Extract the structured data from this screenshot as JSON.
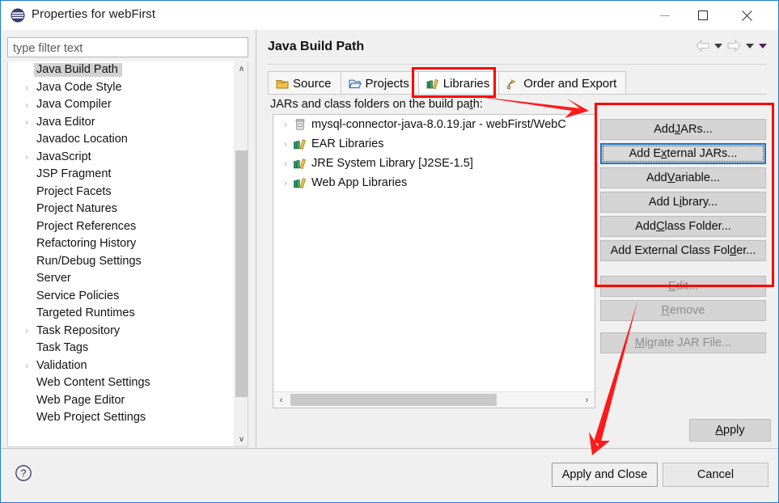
{
  "window": {
    "title": "Properties for webFirst",
    "icon": "eclipse-sphere-icon",
    "minimize_label": "Minimize",
    "maximize_label": "Maximize",
    "close_label": "Close"
  },
  "sidebar": {
    "filter": {
      "value": "",
      "placeholder": "type filter text"
    },
    "items": [
      {
        "label": "Java Build Path",
        "expandable": false,
        "selected": true
      },
      {
        "label": "Java Code Style",
        "expandable": true,
        "selected": false
      },
      {
        "label": "Java Compiler",
        "expandable": true,
        "selected": false
      },
      {
        "label": "Java Editor",
        "expandable": true,
        "selected": false
      },
      {
        "label": "Javadoc Location",
        "expandable": false,
        "selected": false
      },
      {
        "label": "JavaScript",
        "expandable": true,
        "selected": false
      },
      {
        "label": "JSP Fragment",
        "expandable": false,
        "selected": false
      },
      {
        "label": "Project Facets",
        "expandable": false,
        "selected": false
      },
      {
        "label": "Project Natures",
        "expandable": false,
        "selected": false
      },
      {
        "label": "Project References",
        "expandable": false,
        "selected": false
      },
      {
        "label": "Refactoring History",
        "expandable": false,
        "selected": false
      },
      {
        "label": "Run/Debug Settings",
        "expandable": false,
        "selected": false
      },
      {
        "label": "Server",
        "expandable": false,
        "selected": false
      },
      {
        "label": "Service Policies",
        "expandable": false,
        "selected": false
      },
      {
        "label": "Targeted Runtimes",
        "expandable": false,
        "selected": false
      },
      {
        "label": "Task Repository",
        "expandable": true,
        "selected": false
      },
      {
        "label": "Task Tags",
        "expandable": false,
        "selected": false
      },
      {
        "label": "Validation",
        "expandable": true,
        "selected": false
      },
      {
        "label": "Web Content Settings",
        "expandable": false,
        "selected": false
      },
      {
        "label": "Web Page Editor",
        "expandable": false,
        "selected": false
      },
      {
        "label": "Web Project Settings",
        "expandable": false,
        "selected": false
      }
    ],
    "scrollbar": {
      "up_glyph": "∧",
      "down_glyph": "∨"
    }
  },
  "main": {
    "title": "Java Build Path",
    "nav": {
      "back_icon": "back-arrow-icon",
      "back_dropdown_icon": "chevron-down-icon",
      "forward_icon": "forward-arrow-icon",
      "forward_dropdown_icon": "chevron-down-icon",
      "menu_dropdown_icon": "chevron-down-icon"
    },
    "tabs": [
      {
        "label": "Source",
        "icon": "source-folder-icon",
        "active": false
      },
      {
        "label": "Projects",
        "icon": "open-folder-icon",
        "active": false
      },
      {
        "label": "Libraries",
        "icon": "library-books-icon",
        "active": true
      },
      {
        "label": "Order and Export",
        "icon": "order-export-icon",
        "active": false
      }
    ],
    "list_caption_before": "JARs and class folders on the build pa",
    "list_caption_mnemonic": "t",
    "list_caption_after": "h:",
    "jar_entries": [
      {
        "label": "mysql-connector-java-8.0.19.jar - webFirst/WebC",
        "icon": "jar-icon",
        "expandable": true
      },
      {
        "label": "EAR Libraries",
        "icon": "library-icon",
        "expandable": true
      },
      {
        "label": "JRE System Library [J2SE-1.5]",
        "icon": "library-icon",
        "expandable": true
      },
      {
        "label": "Web App Libraries",
        "icon": "library-icon",
        "expandable": true
      }
    ],
    "hscrollbar": {
      "left_glyph": "‹",
      "right_glyph": "›"
    },
    "buttons": [
      {
        "pre": "Add ",
        "mnemonic": "J",
        "post": "ARs...",
        "state": "normal"
      },
      {
        "pre": "Add E",
        "mnemonic": "x",
        "post": "ternal JARs...",
        "state": "focused"
      },
      {
        "pre": "Add ",
        "mnemonic": "V",
        "post": "ariable...",
        "state": "normal"
      },
      {
        "pre": "Add L",
        "mnemonic": "i",
        "post": "brary...",
        "state": "normal"
      },
      {
        "pre": "Add ",
        "mnemonic": "C",
        "post": "lass Folder...",
        "state": "normal"
      },
      {
        "pre": "Add External Class Fol",
        "mnemonic": "d",
        "post": "er...",
        "state": "normal"
      }
    ],
    "buttons2": [
      {
        "pre": "",
        "mnemonic": "E",
        "post": "dit...",
        "state": "disabled"
      },
      {
        "pre": "",
        "mnemonic": "R",
        "post": "emove",
        "state": "disabled"
      }
    ],
    "buttons3": [
      {
        "pre": "",
        "mnemonic": "M",
        "post": "igrate JAR File...",
        "state": "disabled"
      }
    ],
    "apply": {
      "pre": "",
      "mnemonic": "A",
      "post": "pply"
    }
  },
  "footer": {
    "help_icon": "help-question-icon",
    "apply_and_close_label": "Apply and Close",
    "cancel_label": "Cancel"
  },
  "annotations": {
    "accent_color": "#fe0000",
    "boxes": [
      {
        "name": "libraries-tab-highlight"
      },
      {
        "name": "add-buttons-highlight"
      }
    ],
    "arrows": [
      {
        "name": "arrow-tab-to-buttons"
      },
      {
        "name": "arrow-to-apply-and-close"
      }
    ]
  }
}
